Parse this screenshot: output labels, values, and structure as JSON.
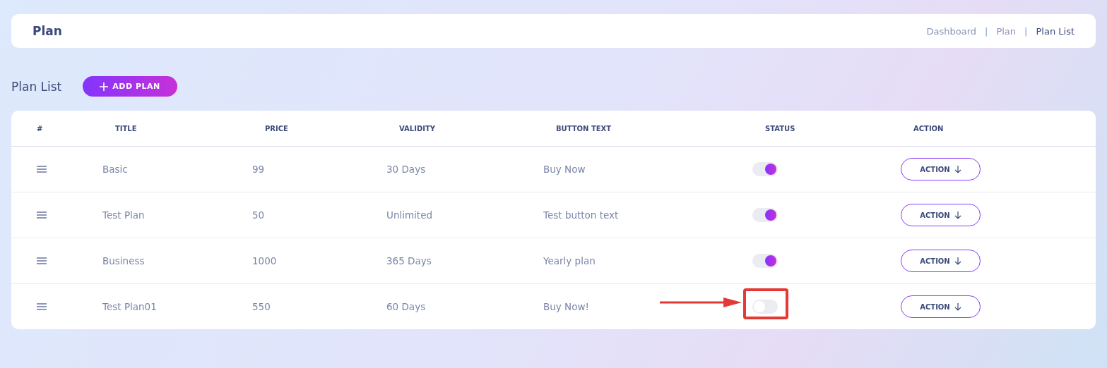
{
  "header": {
    "title": "Plan",
    "breadcrumb": [
      {
        "label": "Dashboard",
        "current": false
      },
      {
        "label": "Plan",
        "current": false
      },
      {
        "label": "Plan List",
        "current": true
      }
    ],
    "separator": "|"
  },
  "section": {
    "title": "Plan List",
    "add_button": "ADD PLAN"
  },
  "table": {
    "columns": [
      "#",
      "TITLE",
      "PRICE",
      "VALIDITY",
      "BUTTON TEXT",
      "STATUS",
      "ACTION"
    ],
    "rows": [
      {
        "title": "Basic",
        "price": "99",
        "validity": "30 Days",
        "button_text": "Buy Now",
        "on": true,
        "action": "ACTION",
        "highlighted": false
      },
      {
        "title": "Test Plan",
        "price": "50",
        "validity": "Unlimited",
        "button_text": "Test button text",
        "on": true,
        "action": "ACTION",
        "highlighted": false
      },
      {
        "title": "Business",
        "price": "1000",
        "validity": "365 Days",
        "button_text": "Yearly plan",
        "on": true,
        "action": "ACTION",
        "highlighted": false
      },
      {
        "title": "Test Plan01",
        "price": "550",
        "validity": "60 Days",
        "button_text": "Buy Now!",
        "on": false,
        "action": "ACTION",
        "highlighted": true
      }
    ]
  }
}
